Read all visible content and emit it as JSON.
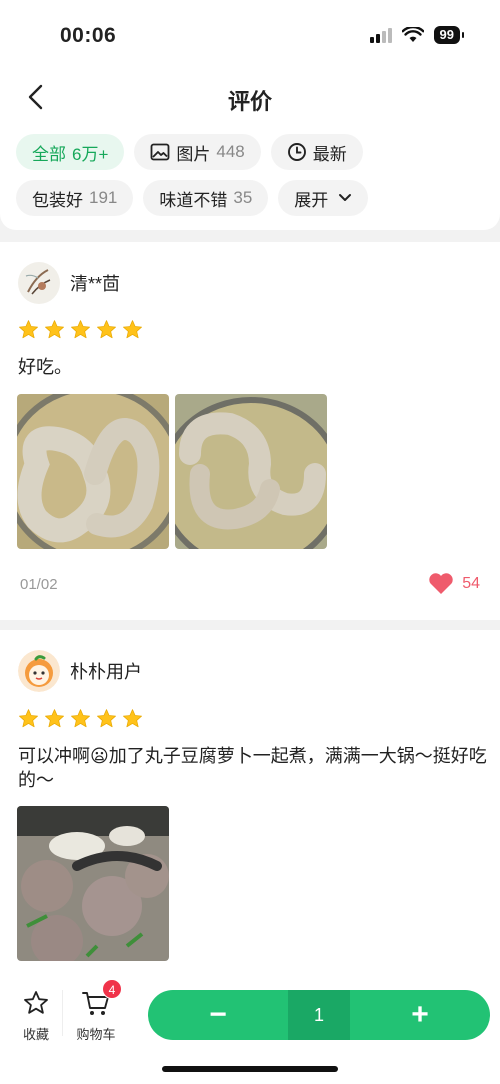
{
  "status_bar": {
    "time": "00:06",
    "battery": "99"
  },
  "header": {
    "title": "评价"
  },
  "filters": {
    "row1": [
      {
        "label": "全部",
        "count": "6万+",
        "active": true
      },
      {
        "label": "图片",
        "count": "448",
        "icon": "image-icon"
      },
      {
        "label": "最新",
        "count": "",
        "icon": "clock-icon"
      }
    ],
    "row2": [
      {
        "label": "包装好",
        "count": "191"
      },
      {
        "label": "味道不错",
        "count": "35"
      },
      {
        "label": "展开",
        "count": "",
        "icon": "chevron-down-icon"
      }
    ]
  },
  "reviews": [
    {
      "user": "清**茴",
      "rating": 5,
      "text": "好吃。",
      "date": "01/02",
      "likes": "54",
      "photos": 2
    },
    {
      "user": "朴朴用户",
      "rating": 5,
      "text": "可以冲啊😦加了丸子豆腐萝卜一起煮，满满一大锅～挺好吃的～",
      "photos": 1
    }
  ],
  "bottom_bar": {
    "favorite_label": "收藏",
    "cart_label": "购物车",
    "cart_badge": "4",
    "quantity": "1",
    "minus_label": "−",
    "plus_label": "+"
  },
  "colors": {
    "accent": "#22c274",
    "accent_dark": "#1aa865",
    "like": "#ef5b6c",
    "badge": "#f0334a",
    "star": "#ffc21a"
  }
}
